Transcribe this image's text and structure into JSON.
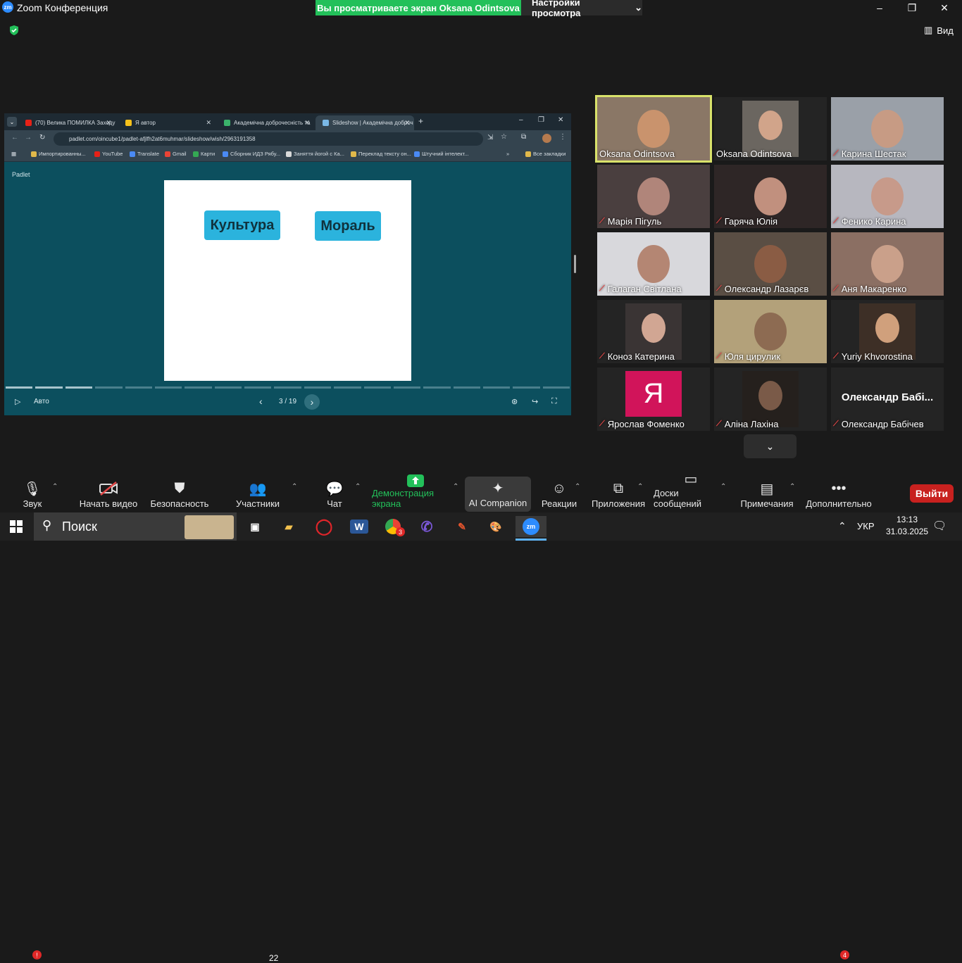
{
  "window": {
    "app_title": "Zoom Конференция",
    "share_banner": "Вы просматриваете экран Oksana Odintsova",
    "view_settings": "Настройки просмотра",
    "view_label": "Вид"
  },
  "browser": {
    "tabs": [
      {
        "label": "(70) Велика ПОМИЛКА Заходу",
        "active": false
      },
      {
        "label": "Я автор",
        "active": false
      },
      {
        "label": "Академічна доброчесність та",
        "active": false
      },
      {
        "label": "Slideshow | Академічна доброч",
        "active": true
      }
    ],
    "url": "padlet.com/oincube1/padlet-afjlfh2at6muhmar/slideshow/wish/2963191358",
    "bookmarks": [
      "Импортированны...",
      "YouTube",
      "Translate",
      "Gmail",
      "Карти",
      "Сборник ИДЗ Рябу...",
      "Заняття йогой с Ка...",
      "Переклад тексту он...",
      "Штучний інтелект..."
    ],
    "all_bookmarks": "Все закладки"
  },
  "slideshow": {
    "brand": "Padlet",
    "chips": [
      "Культура",
      "Мораль"
    ],
    "auto_label": "Авто",
    "current": 3,
    "total": 19,
    "counter": "3 / 19"
  },
  "participants": [
    {
      "name": "Oksana Odintsova",
      "muted": false,
      "active": true
    },
    {
      "name": "Oksana Odintsova",
      "muted": false,
      "active": false
    },
    {
      "name": "Карина Шестак",
      "muted": true,
      "active": false
    },
    {
      "name": "Марія Пігуль",
      "muted": true,
      "active": false
    },
    {
      "name": "Гаряча Юлія",
      "muted": true,
      "active": false
    },
    {
      "name": "Феникo Карина",
      "muted": true,
      "active": false
    },
    {
      "name": "Галаган Світлана",
      "muted": true,
      "active": false
    },
    {
      "name": "Олександр Лазарєв",
      "muted": true,
      "active": false
    },
    {
      "name": "Аня Макаренко",
      "muted": true,
      "active": false
    },
    {
      "name": "Коноз Катерина",
      "muted": true,
      "active": false
    },
    {
      "name": "Юля цирулик",
      "muted": true,
      "active": false
    },
    {
      "name": "Yuriy Khvorostina",
      "muted": true,
      "active": false
    },
    {
      "name": "Ярослав Фоменко",
      "muted": true,
      "active": false,
      "avatar_letter": "Я"
    },
    {
      "name": "Аліна Лахіна",
      "muted": true,
      "active": false
    },
    {
      "name": "Олександр Бабічев",
      "muted": true,
      "active": false,
      "display_text": "Олександр  Бабі..."
    }
  ],
  "toolbar": {
    "audio": "Звук",
    "video": "Начать видео",
    "security": "Безопасность",
    "participants": "Участники",
    "participants_count": "22",
    "chat": "Чат",
    "share": "Демонстрация экрана",
    "ai": "AI Companion",
    "reactions": "Реакции",
    "apps": "Приложения",
    "whiteboards": "Доски сообщений",
    "notes": "Примечания",
    "more": "Дополнительно",
    "more_badge": "4",
    "audio_badge": "!",
    "leave": "Выйти"
  },
  "taskbar": {
    "search": "Поиск",
    "lang": "УКР",
    "time": "13:13",
    "date": "31.03.2025",
    "chrome_badge": "3"
  },
  "colors": {
    "share_green": "#23c05a",
    "zoom_blue": "#2d8cff",
    "leave_red": "#c8211f",
    "padlet_bg": "#0c4f5e",
    "chip": "#2bb3dd",
    "avatar_pink": "#d1145a"
  }
}
